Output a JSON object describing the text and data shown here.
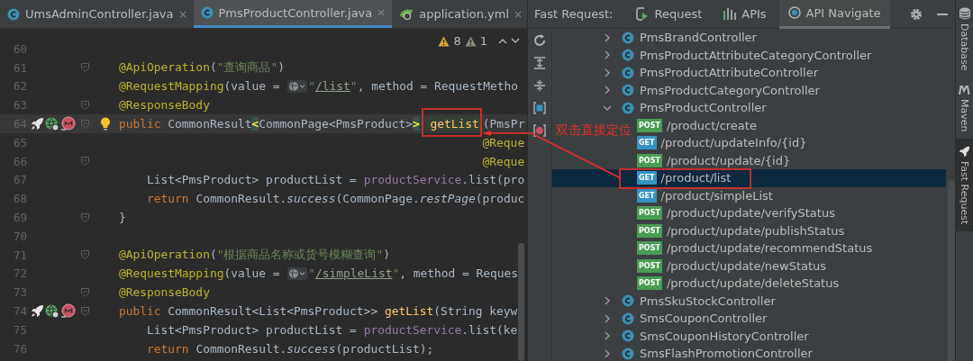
{
  "editor": {
    "tabs": [
      {
        "label": "UmsAdminController.java",
        "kind": "java",
        "selected": false
      },
      {
        "label": "PmsProductController.java",
        "kind": "java",
        "selected": true
      },
      {
        "label": "application.yml",
        "kind": "yaml",
        "selected": false
      }
    ],
    "inspection": {
      "warnings": "8",
      "weak_warnings": "1"
    },
    "lines": [
      {
        "num": "60"
      },
      {
        "num": "61",
        "fold": true,
        "tokens": [
          {
            "kind": "ann",
            "text": "@ApiOperation"
          },
          {
            "kind": "plain",
            "text": "("
          },
          {
            "kind": "str",
            "text": "\"查询商品\""
          },
          {
            "kind": "plain",
            "text": ")"
          }
        ]
      },
      {
        "num": "62",
        "tokens": [
          {
            "kind": "ann",
            "text": "@RequestMapping"
          },
          {
            "kind": "plain",
            "text": "(value = "
          },
          {
            "kind": "globe"
          },
          {
            "kind": "str",
            "text": "\""
          },
          {
            "kind": "link",
            "text": "/list"
          },
          {
            "kind": "str",
            "text": "\""
          },
          {
            "kind": "plain",
            "text": ", method = RequestMetho"
          }
        ]
      },
      {
        "num": "63",
        "fold": true,
        "tokens": [
          {
            "kind": "ann",
            "text": "@ResponseBody"
          }
        ]
      },
      {
        "num": "64",
        "fold": true,
        "run_icons": true,
        "bulb": true,
        "current": true,
        "tokens": [
          {
            "kind": "kw",
            "text": "public "
          },
          {
            "kind": "plain",
            "text": "CommonResult"
          },
          {
            "kind": "match",
            "text": "<"
          },
          {
            "kind": "plain",
            "text": "CommonPage<PmsProduct>"
          },
          {
            "kind": "match",
            "text": ">"
          },
          {
            "kind": "declhl",
            "text": "getList"
          },
          {
            "kind": "plain",
            "text": "(PmsPr"
          }
        ]
      },
      {
        "num": "65",
        "tokens": [
          {
            "kind": "ann",
            "text": "                                                    @Reque"
          }
        ]
      },
      {
        "num": "66",
        "fold": true,
        "tokens": [
          {
            "kind": "ann",
            "text": "                                                    @Reque"
          }
        ]
      },
      {
        "num": "67",
        "tokens": [
          {
            "kind": "plain",
            "text": "    List<PmsProduct> productList = "
          },
          {
            "kind": "field",
            "text": "productService"
          },
          {
            "kind": "plain",
            "text": ".list(pro"
          }
        ]
      },
      {
        "num": "68",
        "tokens": [
          {
            "kind": "kw",
            "text": "    return "
          },
          {
            "kind": "plain",
            "text": "CommonResult."
          },
          {
            "kind": "static",
            "text": "success"
          },
          {
            "kind": "plain",
            "text": "(CommonPage."
          },
          {
            "kind": "static",
            "text": "restPage"
          },
          {
            "kind": "plain",
            "text": "(produc"
          }
        ]
      },
      {
        "num": "69",
        "fold": true,
        "tokens": [
          {
            "kind": "plain",
            "text": "}"
          }
        ]
      },
      {
        "num": "70"
      },
      {
        "num": "71",
        "fold": true,
        "tokens": [
          {
            "kind": "ann",
            "text": "@ApiOperation"
          },
          {
            "kind": "plain",
            "text": "("
          },
          {
            "kind": "str",
            "text": "\"根据商品名称或货号模糊查询\""
          },
          {
            "kind": "plain",
            "text": ")"
          }
        ]
      },
      {
        "num": "72",
        "tokens": [
          {
            "kind": "ann",
            "text": "@RequestMapping"
          },
          {
            "kind": "plain",
            "text": "(value = "
          },
          {
            "kind": "globe"
          },
          {
            "kind": "str",
            "text": "\""
          },
          {
            "kind": "link",
            "text": "/simpleList"
          },
          {
            "kind": "str",
            "text": "\""
          },
          {
            "kind": "plain",
            "text": ", method = Reques"
          }
        ]
      },
      {
        "num": "73",
        "fold": true,
        "tokens": [
          {
            "kind": "ann",
            "text": "@ResponseBody"
          }
        ]
      },
      {
        "num": "74",
        "fold": true,
        "run_icons": true,
        "tokens": [
          {
            "kind": "kw",
            "text": "public "
          },
          {
            "kind": "plain",
            "text": "CommonResult<List<PmsProduct>> "
          },
          {
            "kind": "decl",
            "text": "getList"
          },
          {
            "kind": "plain",
            "text": "(String keyw"
          }
        ]
      },
      {
        "num": "75",
        "tokens": [
          {
            "kind": "plain",
            "text": "    List<PmsProduct> productList = "
          },
          {
            "kind": "field",
            "text": "productService"
          },
          {
            "kind": "plain",
            "text": ".list(ke"
          }
        ]
      },
      {
        "num": "76",
        "tokens": [
          {
            "kind": "kw",
            "text": "    return "
          },
          {
            "kind": "plain",
            "text": "CommonResult."
          },
          {
            "kind": "static",
            "text": "success"
          },
          {
            "kind": "plain",
            "text": "(productList);"
          }
        ]
      }
    ]
  },
  "tool_window": {
    "title": "Fast Request:",
    "tabs": [
      {
        "label": "Request",
        "selected": false
      },
      {
        "label": "APIs",
        "selected": false
      },
      {
        "label": "API Navigate",
        "selected": true
      }
    ],
    "tree": [
      {
        "label": "PmsBrandController",
        "expanded": false,
        "selected": false
      },
      {
        "label": "PmsProductAttributeCategoryController",
        "expanded": false,
        "selected": false
      },
      {
        "label": "PmsProductAttributeController",
        "expanded": false,
        "selected": false
      },
      {
        "label": "PmsProductCategoryController",
        "expanded": false,
        "selected": false
      },
      {
        "label": "PmsProductController",
        "expanded": true,
        "selected": false,
        "children": [
          {
            "method": "POST",
            "color": "#499c54",
            "path": "/product/create",
            "selected": false
          },
          {
            "method": "GET",
            "color": "#3592c4",
            "path": "/product/updateInfo/{id}",
            "selected": false
          },
          {
            "method": "POST",
            "color": "#499c54",
            "path": "/product/update/{id}",
            "selected": false
          },
          {
            "method": "GET",
            "color": "#3592c4",
            "path": "/product/list",
            "selected": true
          },
          {
            "method": "GET",
            "color": "#3592c4",
            "path": "/product/simpleList",
            "selected": false
          },
          {
            "method": "POST",
            "color": "#499c54",
            "path": "/product/update/verifyStatus",
            "selected": false
          },
          {
            "method": "POST",
            "color": "#499c54",
            "path": "/product/update/publishStatus",
            "selected": false
          },
          {
            "method": "POST",
            "color": "#499c54",
            "path": "/product/update/recommendStatus",
            "selected": false
          },
          {
            "method": "POST",
            "color": "#499c54",
            "path": "/product/update/newStatus",
            "selected": false
          },
          {
            "method": "POST",
            "color": "#499c54",
            "path": "/product/update/deleteStatus",
            "selected": false
          }
        ]
      },
      {
        "label": "PmsSkuStockController",
        "expanded": false,
        "selected": false
      },
      {
        "label": "SmsCouponController",
        "expanded": false,
        "selected": false
      },
      {
        "label": "SmsCouponHistoryController",
        "expanded": false,
        "selected": false
      },
      {
        "label": "SmsFlashPromotionController",
        "expanded": false,
        "selected": false
      }
    ]
  },
  "side_strip": [
    {
      "label": "Database",
      "selected": false
    },
    {
      "label": "Maven",
      "selected": false
    },
    {
      "label": "Fast Request",
      "selected": true
    }
  ],
  "annotation": {
    "label": "双击直接定位"
  }
}
